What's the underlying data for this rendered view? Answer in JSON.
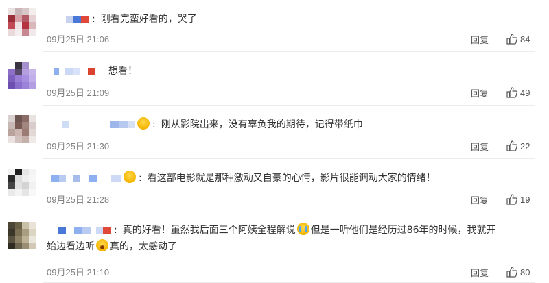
{
  "comments": [
    {
      "text": "刚看完蛮好看的，哭了",
      "time": "09月25日 21:06",
      "reply_label": "回复",
      "likes": "84"
    },
    {
      "text": "想看！",
      "time": "09月25日 21:09",
      "reply_label": "回复",
      "likes": "49"
    },
    {
      "text": "刚从影院出来，没有辜负我的期待，记得带纸巾",
      "time": "09月25日 21:30",
      "reply_label": "回复",
      "likes": "22"
    },
    {
      "text": "看这部电影就是那种激动又自豪的心情，影片很能调动大家的情绪！",
      "time": "09月25日 21:28",
      "reply_label": "回复",
      "likes": "19"
    },
    {
      "text_part1": "真的好看！虽然我后面三个阿姨全程解说",
      "text_part2": "但是一听他们是经历过86年的时候，我就开",
      "text_part3": "始边看边听",
      "text_part4": "真的，太感动了",
      "time": "09月25日 21:10",
      "reply_label": "回复",
      "likes": "80"
    }
  ],
  "icons": {
    "like": "thumbs-up-icon",
    "emoji_cry": "crying-laughing-emoji-icon",
    "emoji_shock": "shocked-emoji-icon"
  },
  "colors": {
    "text": "#333333",
    "meta": "#808080",
    "mosaic_blue": "#4a78d8",
    "mosaic_red": "#e0483a"
  }
}
